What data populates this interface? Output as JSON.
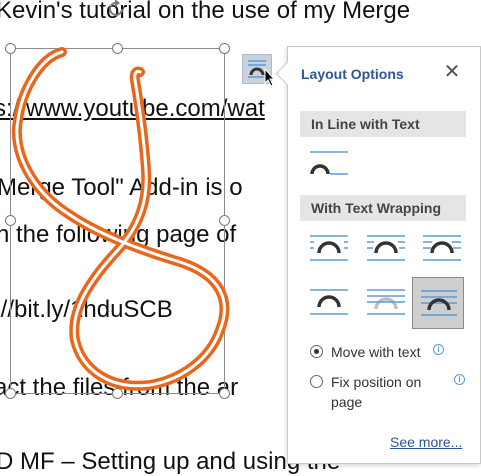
{
  "document": {
    "lines": [
      "Kevin's tutorial on the use of my Merge",
      "s://www.youtube.com/wat",
      "Merge Tool\" Add-in is o",
      "n the following page of",
      "://bit.ly/1hduSCB",
      "act the files from the ar",
      "D MF – Setting up and using the"
    ]
  },
  "launcher": {
    "icon": "layout-options-icon"
  },
  "layout_options": {
    "title": "Layout Options",
    "close_label": "✕",
    "inline_heading": "In Line with Text",
    "wrapping_heading": "With Text Wrapping",
    "selected_wrap_index": 5,
    "accent_color": "#5b9bd5",
    "move_with_text_label": "Move with text",
    "fix_position_label": "Fix position on page",
    "move_with_text_selected": true,
    "see_more_label": "See more..."
  },
  "ink": {
    "color": "#e8671c"
  }
}
